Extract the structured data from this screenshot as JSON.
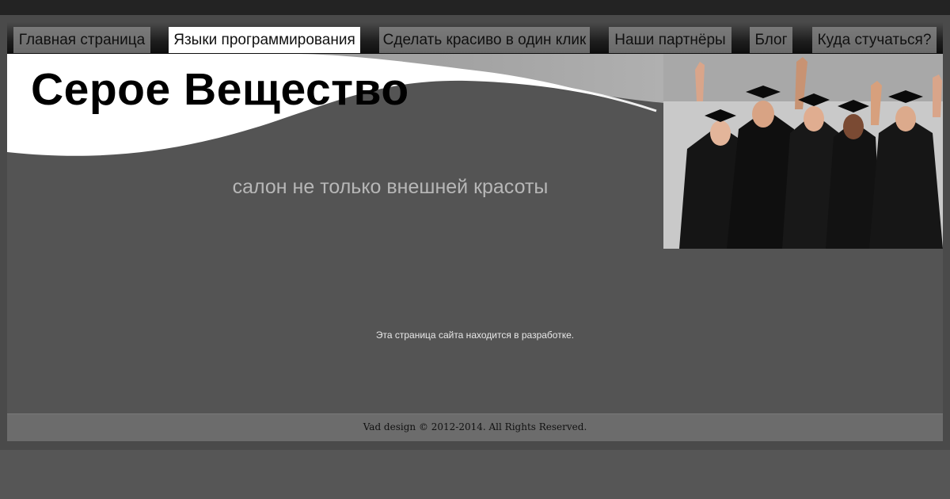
{
  "nav": {
    "items": [
      {
        "label": "Главная страница",
        "active": false
      },
      {
        "label": "Языки программирования",
        "active": true
      },
      {
        "label": "Сделать красиво в один клик",
        "active": false
      },
      {
        "label": "Наши партнёры",
        "active": false
      },
      {
        "label": "Блог",
        "active": false
      },
      {
        "label": "Куда стучаться?",
        "active": false
      }
    ]
  },
  "header": {
    "title": "Серое Вещество",
    "tagline": "салон не только внешней красоты",
    "photo_icon": "graduates-photo"
  },
  "content": {
    "notice": "Эта страница сайта находится в разработке."
  },
  "footer": {
    "copyright": "Vad design © 2012-2014. All Rights Reserved."
  },
  "colors": {
    "background": "#565656",
    "active_tab": "#ffffff",
    "tab": "#6e6e6e",
    "tagline": "#b7b7b7"
  }
}
